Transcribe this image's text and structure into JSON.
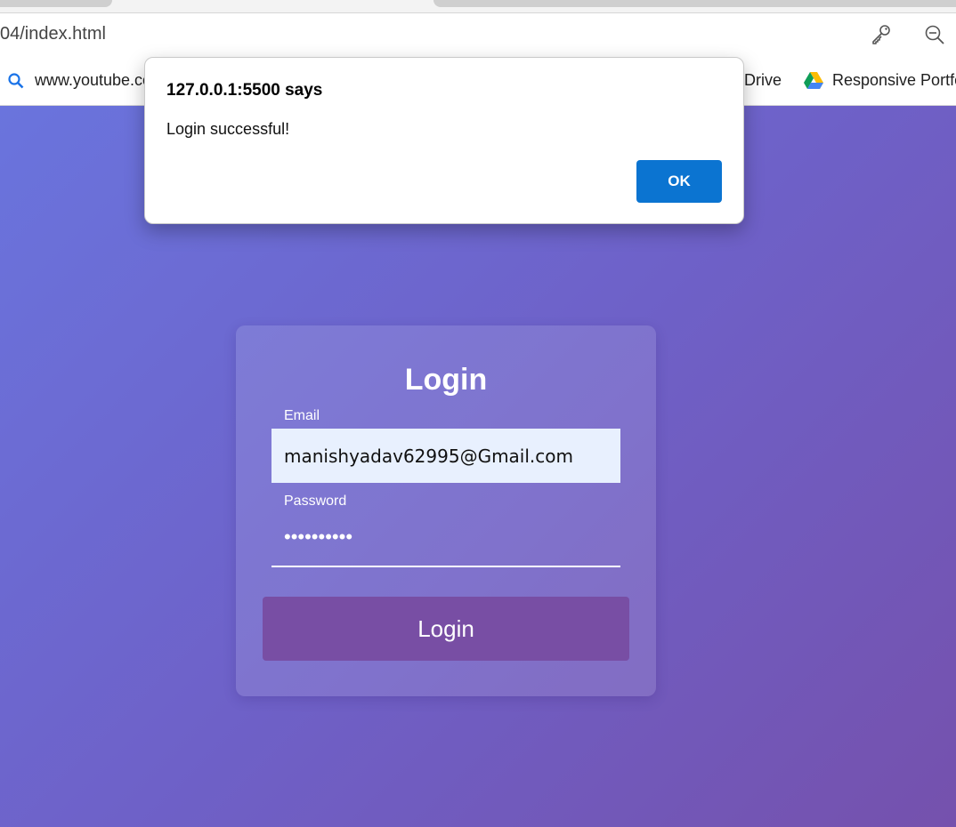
{
  "browser": {
    "url": "04/index.html",
    "icons": {
      "key": "key-icon",
      "zoom_out": "zoom-out-icon"
    },
    "bookmarks": [
      {
        "label": "www.youtube.co",
        "icon": "search-icon"
      },
      {
        "label": "Drive",
        "icon": ""
      },
      {
        "label": "Responsive Portfo",
        "icon": "google-drive-icon"
      }
    ]
  },
  "dialog": {
    "title": "127.0.0.1:5500 says",
    "message": "Login successful!",
    "ok_label": "OK",
    "ok_color": "#0b74d1"
  },
  "login_form": {
    "title": "Login",
    "email_label": "Email",
    "email_value": "manishyadav62995@Gmail.com",
    "password_label": "Password",
    "password_mask": "••••••••••",
    "submit_label": "Login",
    "submit_color": "#784ea4",
    "background_gradient": [
      "#6a74dd",
      "#7551ad"
    ]
  }
}
